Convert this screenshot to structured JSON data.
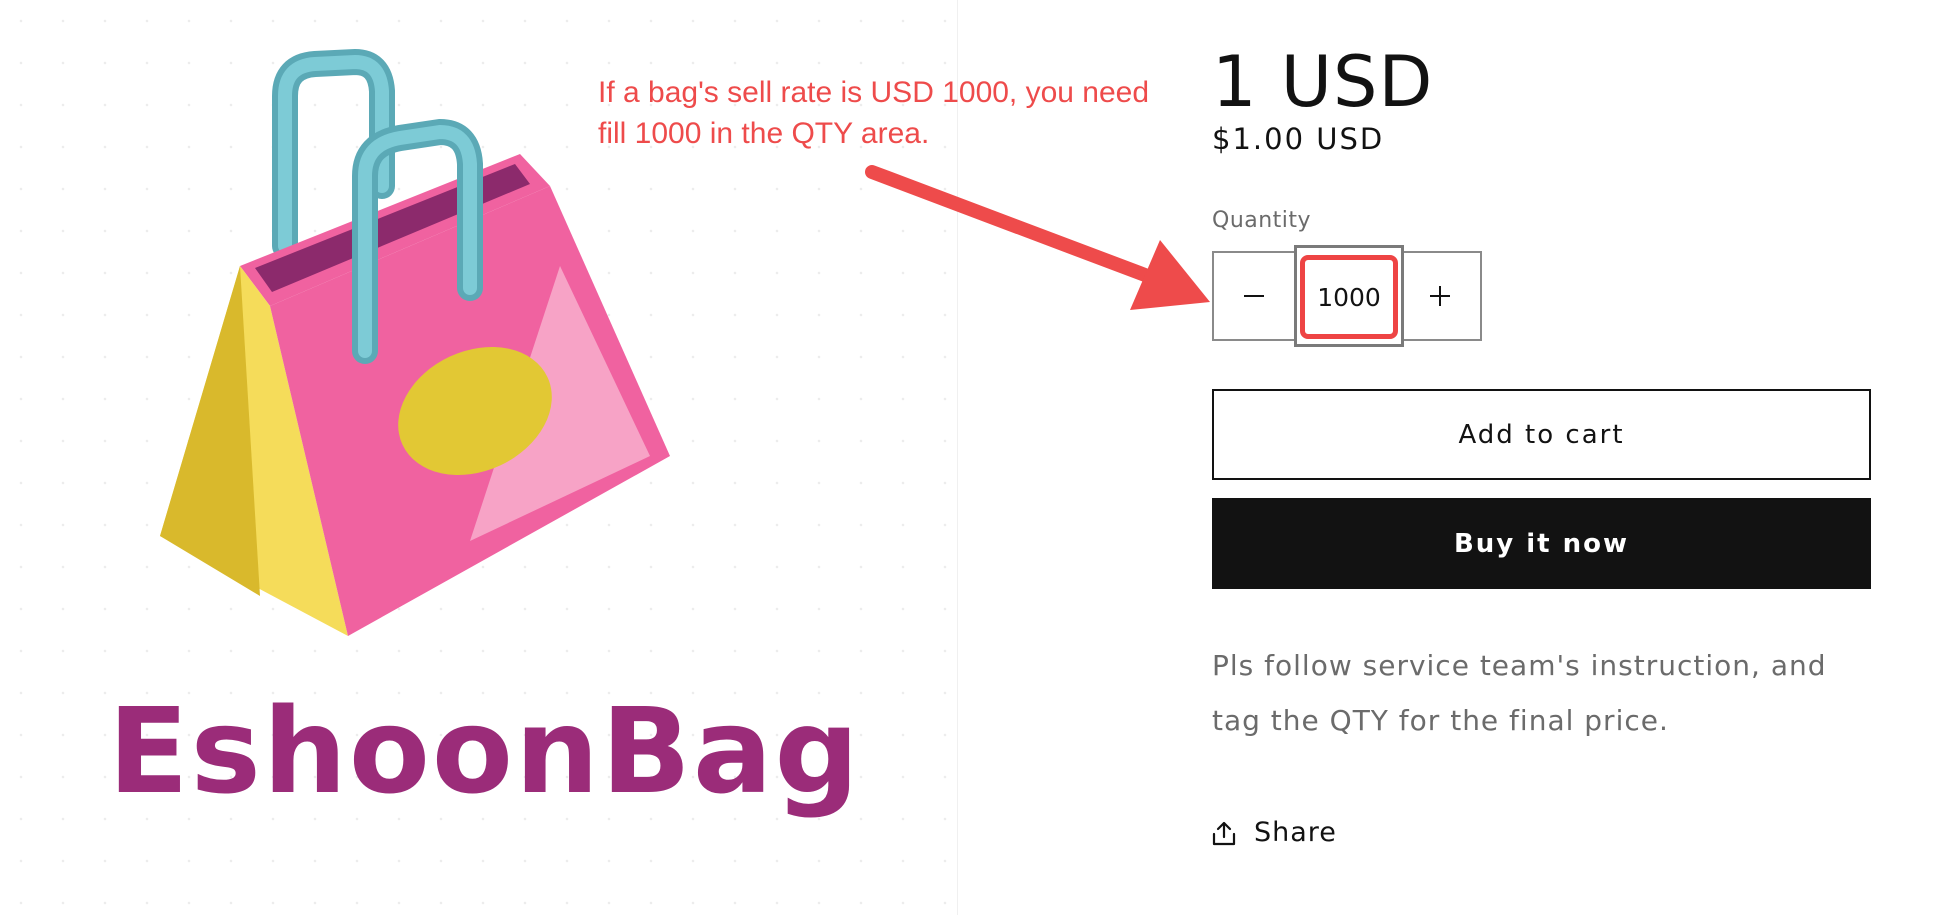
{
  "brand": {
    "name": "EshoonBag",
    "colors": {
      "brand_purple": "#9b2c79",
      "bag_pink": "#f062a0",
      "bag_yellow": "#f5dc5a",
      "handle_teal": "#74c3cf"
    }
  },
  "annotation": {
    "text": "If a bag's sell rate is USD 1000, you need fill 1000 in the QTY area.",
    "color": "#ee4b4b"
  },
  "product": {
    "title": "1 USD",
    "price": "$1.00 USD",
    "quantity": {
      "label": "Quantity",
      "decrease_icon": "minus-icon",
      "increase_icon": "plus-icon",
      "value": "1000"
    },
    "add_to_cart_label": "Add to cart",
    "buy_now_label": "Buy it now",
    "description": "Pls follow service team's instruction, and tag the QTY for the final price.",
    "share_label": "Share",
    "share_icon": "share-icon"
  }
}
